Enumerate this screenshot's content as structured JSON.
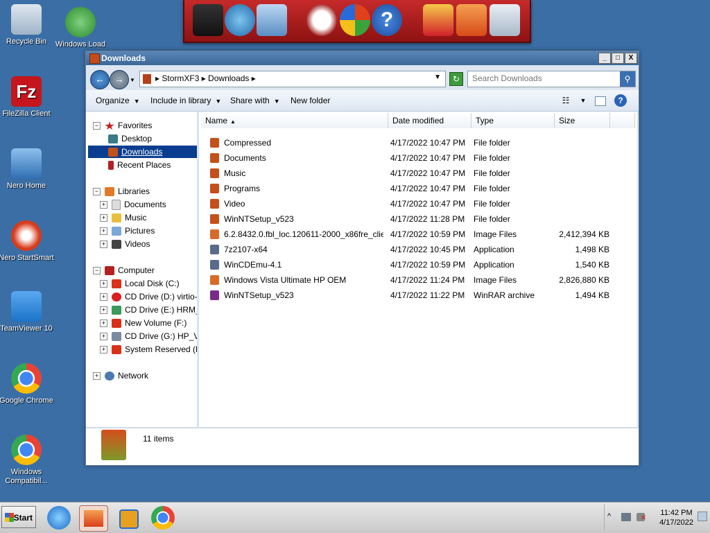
{
  "desktop_icons": [
    {
      "label": "Recycle Bin",
      "color": "#9fb3c8"
    },
    {
      "label": "Windows Load",
      "color": "#3aa43a"
    },
    {
      "label": "FileZilla Client",
      "color": "#c4161c"
    },
    {
      "label": "Nero Home",
      "color": "#2f6fb3"
    },
    {
      "label": "Nero StartSmart",
      "color": "#d83a1a"
    },
    {
      "label": "TeamViewer 10",
      "color": "#1b74c8"
    },
    {
      "label": "Google Chrome",
      "color": "#4285f4"
    },
    {
      "label": "Windows Compatibil...",
      "color": "#4285f4"
    }
  ],
  "window": {
    "title": "Downloads",
    "min": "_",
    "max": "□",
    "close": "X",
    "back": "←",
    "forward": "→",
    "crumbs": "▸  StormXF3  ▸  Downloads  ▸",
    "address_dropdown": "▼",
    "refresh": "↻",
    "search_placeholder": "Search Downloads",
    "search_icon": "⚲"
  },
  "toolbar": {
    "organize": "Organize",
    "include": "Include in library",
    "share": "Share with",
    "new_folder": "New folder",
    "caret": "▼"
  },
  "nav": {
    "favorites": "Favorites",
    "desktop": "Desktop",
    "downloads": "Downloads",
    "recent": "Recent Places",
    "libraries": "Libraries",
    "documents": "Documents",
    "music": "Music",
    "pictures": "Pictures",
    "videos": "Videos",
    "computer": "Computer",
    "c": "Local Disk (C:)",
    "d": "CD Drive (D:) virtio-win",
    "e": "CD Drive (E:) HRM_CC",
    "f": "New Volume (F:)",
    "g": "CD Drive (G:) HP_VIST",
    "h": "System Reserved (H:)",
    "network": "Network"
  },
  "columns": {
    "name": "Name",
    "date": "Date modified",
    "type": "Type",
    "size": "Size"
  },
  "files": [
    {
      "name": "Compressed",
      "date": "4/17/2022 10:47 PM",
      "type": "File folder",
      "size": ""
    },
    {
      "name": "Documents",
      "date": "4/17/2022 10:47 PM",
      "type": "File folder",
      "size": ""
    },
    {
      "name": "Music",
      "date": "4/17/2022 10:47 PM",
      "type": "File folder",
      "size": ""
    },
    {
      "name": "Programs",
      "date": "4/17/2022 10:47 PM",
      "type": "File folder",
      "size": ""
    },
    {
      "name": "Video",
      "date": "4/17/2022 10:47 PM",
      "type": "File folder",
      "size": ""
    },
    {
      "name": "WinNTSetup_v523",
      "date": "4/17/2022 11:28 PM",
      "type": "File folder",
      "size": ""
    },
    {
      "name": "6.2.8432.0.fbl_loc.120611-2000_x86fre_clie...",
      "date": "4/17/2022 10:59 PM",
      "type": "Image Files",
      "size": "2,412,394 KB"
    },
    {
      "name": "7z2107-x64",
      "date": "4/17/2022 10:45 PM",
      "type": "Application",
      "size": "1,498 KB"
    },
    {
      "name": "WinCDEmu-4.1",
      "date": "4/17/2022 10:59 PM",
      "type": "Application",
      "size": "1,540 KB"
    },
    {
      "name": "Windows Vista Ultimate HP OEM",
      "date": "4/17/2022 11:24 PM",
      "type": "Image Files",
      "size": "2,826,880 KB"
    },
    {
      "name": "WinNTSetup_v523",
      "date": "4/17/2022 11:22 PM",
      "type": "WinRAR archive",
      "size": "1,494 KB"
    }
  ],
  "details": {
    "count": "11 items"
  },
  "taskbar": {
    "start": "Start",
    "time": "11:42 PM",
    "date": "4/17/2022",
    "tray_up": "^"
  }
}
